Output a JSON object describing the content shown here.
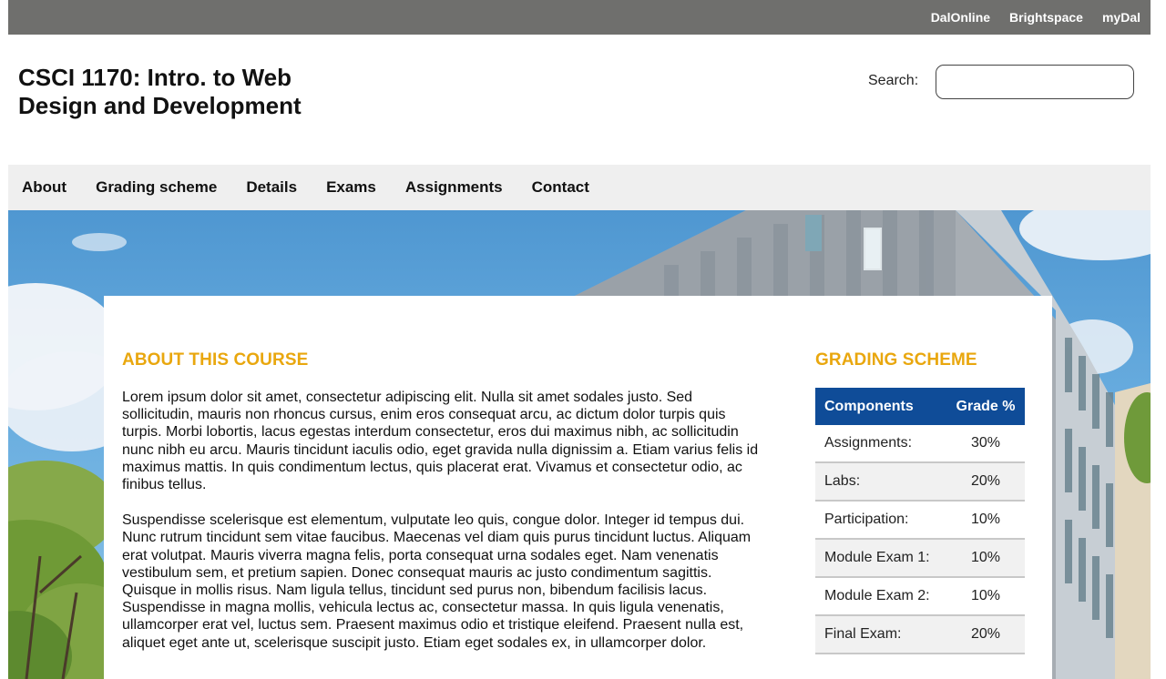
{
  "topbar": {
    "links": [
      "DalOnline",
      "Brightspace",
      "myDal"
    ]
  },
  "header": {
    "title_line1": "CSCI 1170: Intro. to Web",
    "title_line2": "Design and Development",
    "search_label": "Search:",
    "search_value": ""
  },
  "nav": {
    "items": [
      "About",
      "Grading scheme",
      "Details",
      "Exams",
      "Assignments",
      "Contact"
    ]
  },
  "about": {
    "heading": "ABOUT THIS COURSE",
    "paragraphs": [
      "Lorem ipsum dolor sit amet, consectetur adipiscing elit. Nulla sit amet sodales justo. Sed sollicitudin, mauris non rhoncus cursus, enim eros consequat arcu, ac dictum dolor turpis quis turpis. Morbi lobortis, lacus egestas interdum consectetur, eros dui maximus nibh, ac sollicitudin nunc nibh eu arcu. Mauris tincidunt iaculis odio, eget gravida nulla dignissim a. Etiam varius felis id maximus mattis. In quis condimentum lectus, quis placerat erat. Vivamus et consectetur odio, ac finibus tellus.",
      "Suspendisse scelerisque est elementum, vulputate leo quis, congue dolor. Integer id tempus dui. Nunc rutrum tincidunt sem vitae faucibus. Maecenas vel diam quis purus tincidunt luctus. Aliquam erat volutpat. Mauris viverra magna felis, porta consequat urna sodales eget. Nam venenatis vestibulum sem, et pretium sapien. Donec consequat mauris ac justo condimentum sagittis. Quisque in mollis risus. Nam ligula tellus, tincidunt sed purus non, bibendum facilisis lacus. Suspendisse in magna mollis, vehicula lectus ac, consectetur massa. In quis ligula venenatis, ullamcorper erat vel, luctus sem. Praesent maximus odio et tristique eleifend. Praesent nulla est, aliquet eget ante ut, scelerisque suscipit justo. Etiam eget sodales ex, in ullamcorper dolor."
    ]
  },
  "grading": {
    "heading": "GRADING SCHEME",
    "columns": [
      "Components",
      "Grade %"
    ],
    "rows": [
      [
        "Assignments:",
        "30%"
      ],
      [
        "Labs:",
        "20%"
      ],
      [
        "Participation:",
        "10%"
      ],
      [
        "Module Exam 1:",
        "10%"
      ],
      [
        "Module Exam 2:",
        "10%"
      ],
      [
        "Final Exam:",
        "20%"
      ]
    ]
  },
  "colors": {
    "topbar": "#6f6f6d",
    "nav": "#efefef",
    "heading_accent": "#e9a70e",
    "table_header": "#0f4c98"
  }
}
